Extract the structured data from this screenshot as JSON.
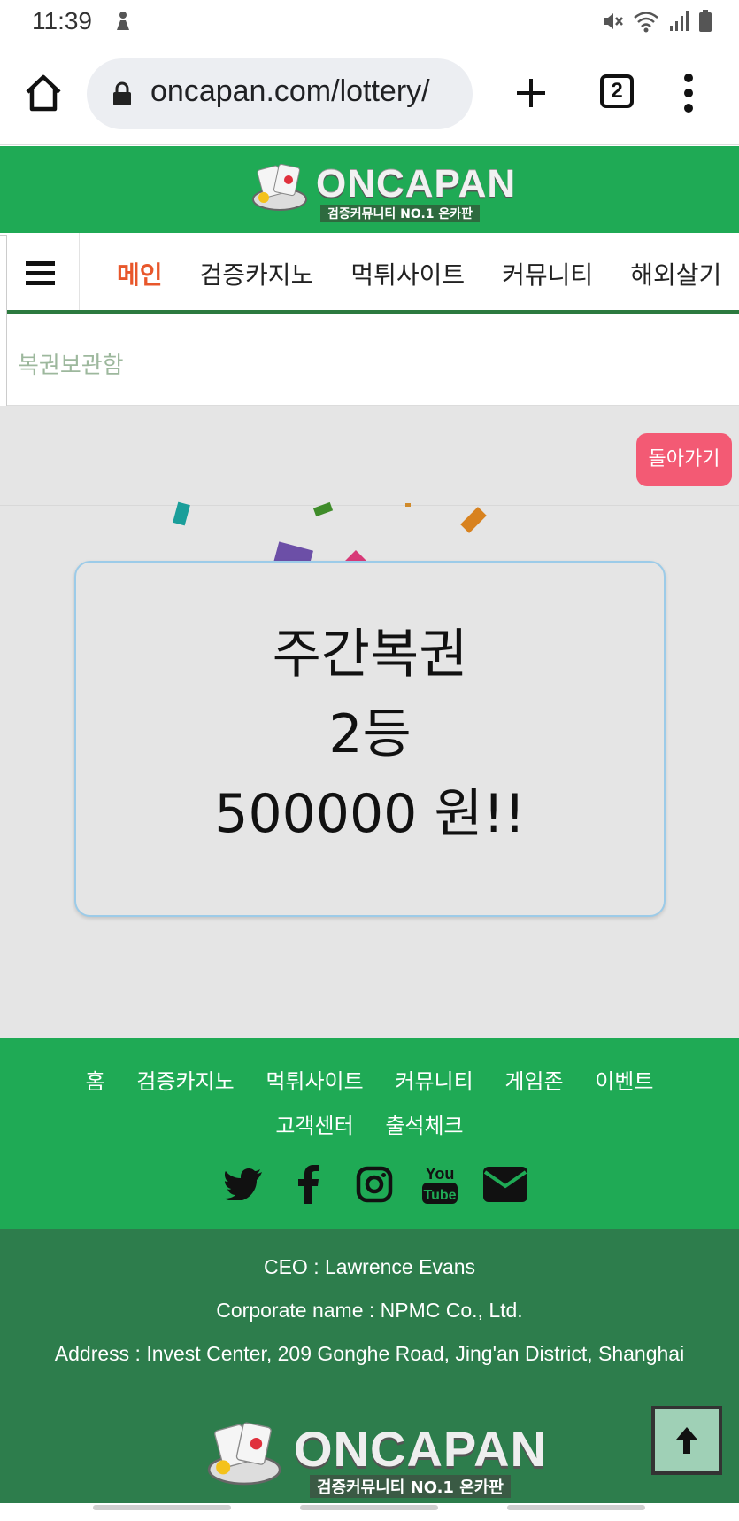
{
  "status_bar": {
    "time": "11:39",
    "icons": [
      "notification-figure-icon",
      "mute-icon",
      "wifi-icon",
      "signal-icon",
      "battery-icon"
    ]
  },
  "browser": {
    "url": "oncapan.com/lottery/",
    "tab_count": "2",
    "icons": [
      "home-icon",
      "lock-icon",
      "plus-icon",
      "more-vert-icon"
    ]
  },
  "header": {
    "logo_title": "ONCAPAN",
    "logo_subtitle": "검증커뮤니티 NO.1 온카판",
    "background_color": "#1faa55"
  },
  "nav": {
    "items": [
      {
        "label": "메인",
        "active": true
      },
      {
        "label": "검증카지노"
      },
      {
        "label": "먹튀사이트"
      },
      {
        "label": "커뮤니티"
      },
      {
        "label": "해외살기"
      }
    ],
    "active_color": "#e8572b"
  },
  "breadcrumb": {
    "label": "복권보관함"
  },
  "main": {
    "back_button": "돌아가기",
    "prize": {
      "name": "주간복권",
      "rank": "2등",
      "amount": "500000 원!!"
    }
  },
  "footer": {
    "links": [
      "홈",
      "검증카지노",
      "먹튀사이트",
      "커뮤니티",
      "게임존",
      "이벤트",
      "고객센터",
      "출석체크"
    ],
    "social": [
      "twitter-icon",
      "facebook-icon",
      "instagram-icon",
      "youtube-icon",
      "email-icon"
    ],
    "ceo": "CEO : Lawrence Evans",
    "corporate": "Corporate name : NPMC Co., Ltd.",
    "address": "Address : Invest Center, 209 Gonghe Road, Jing'an District, Shanghai",
    "logo_title": "ONCAPAN",
    "logo_subtitle": "검증커뮤니티 NO.1 온카판",
    "top_button_icon": "arrow-up-icon"
  }
}
